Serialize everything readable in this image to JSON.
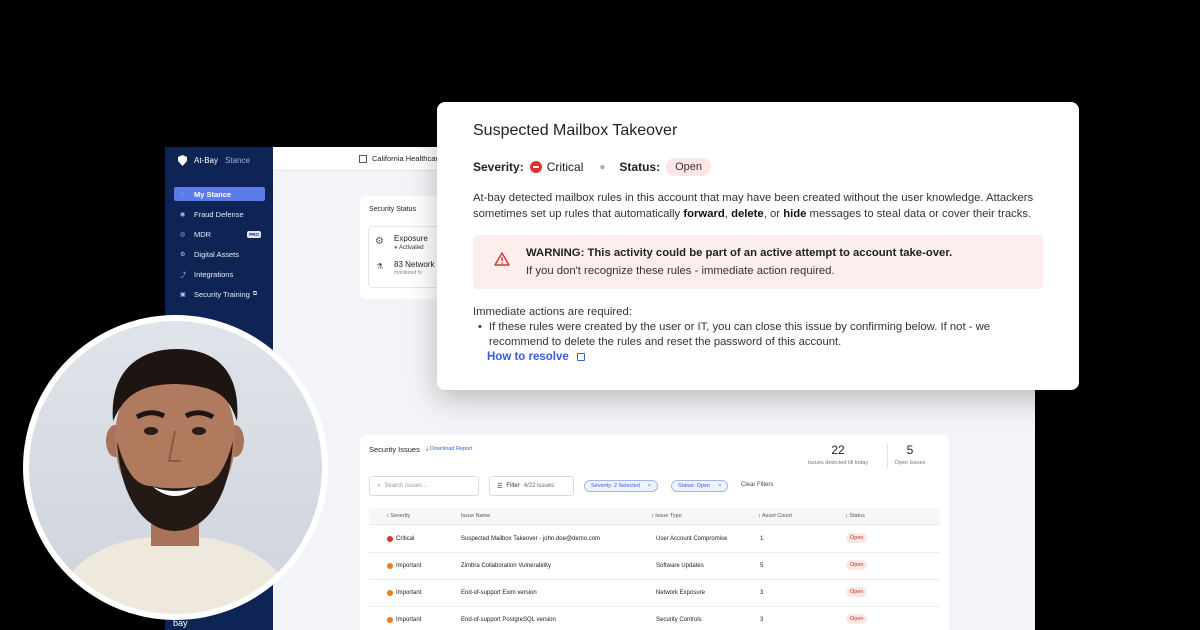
{
  "sidebar": {
    "brand": "At-Bay",
    "brand_product": "Stance",
    "items": [
      {
        "label": "My Stance",
        "icon": "home-icon",
        "active": true
      },
      {
        "label": "Fraud Defense",
        "icon": "shield-icon"
      },
      {
        "label": "MDR",
        "icon": "radar-icon",
        "badge": "PRO"
      },
      {
        "label": "Digital Assets",
        "icon": "cube-icon"
      },
      {
        "label": "Integrations",
        "icon": "plug-icon"
      },
      {
        "label": "Security Training",
        "icon": "graduation-icon",
        "suffix_icon": "external-link-icon"
      }
    ],
    "footer_logo": "bay"
  },
  "topbar": {
    "org_name": "California Healthcare"
  },
  "security_status": {
    "title": "Security Status",
    "exposure_label": "Exposure",
    "exposure_status": "Activated",
    "network_count": "83 Network",
    "network_sub": "monitored fo"
  },
  "issues": {
    "title": "Security Issues",
    "download_label": "Download Report",
    "stats": [
      {
        "value": "22",
        "label": "Issues detected till today"
      },
      {
        "value": "5",
        "label": "Open Issues"
      }
    ],
    "search_placeholder": "Search issues...",
    "filter_label": "Filter",
    "filter_count": "4/22 issues",
    "chips": [
      {
        "label": "Severity: 2 Selected"
      },
      {
        "label": "Status: Open"
      }
    ],
    "clear_filters": "Clear Filters",
    "columns": [
      "Severity",
      "Issue Name",
      "Issue Type",
      "Asset Count",
      "Status"
    ],
    "rows": [
      {
        "severity": "Critical",
        "name": "Suspected Mailbox Takeover - john.doe@demo.com",
        "type": "User Account Compromise",
        "count": "1",
        "status": "Open"
      },
      {
        "severity": "Important",
        "name": "Zimbra Collaboration Vulnerability",
        "type": "Software Updates",
        "count": "5",
        "status": "Open"
      },
      {
        "severity": "Important",
        "name": "End-of-support Exim version",
        "type": "Network Exposure",
        "count": "3",
        "status": "Open"
      },
      {
        "severity": "Important",
        "name": "End-of-support PostgreSQL version",
        "type": "Security Controls",
        "count": "3",
        "status": "Open"
      }
    ]
  },
  "popup": {
    "title": "Suspected Mailbox Takeover",
    "severity_label": "Severity:",
    "severity_value": "Critical",
    "status_label": "Status:",
    "status_value": "Open",
    "desc_start": "At-bay detected mailbox rules in this account that may have been created without the user knowledge. Attackers sometimes set up rules that automatically ",
    "desc_forward": "forward",
    "desc_sep1": ", ",
    "desc_delete": "delete",
    "desc_sep2": ", or ",
    "desc_hide": "hide",
    "desc_end": " messages to steal data or cover their tracks.",
    "warning_title": "WARNING: This activity could be part of an active attempt to account take-over.",
    "warning_sub": "If you don't recognize these rules - immediate action required.",
    "actions_title": "Immediate actions are required:",
    "action_item": "If these rules were created by the user or IT, you can close this issue by confirming below. If not - we recommend to delete the rules and reset the password of this account.",
    "resolve_link": "How to resolve"
  },
  "colors": {
    "sidebar_bg": "#0e2454",
    "accent": "#3b5bdb",
    "critical": "#d9342b",
    "important": "#e97f1f",
    "warning_bg": "#fdeeee"
  }
}
